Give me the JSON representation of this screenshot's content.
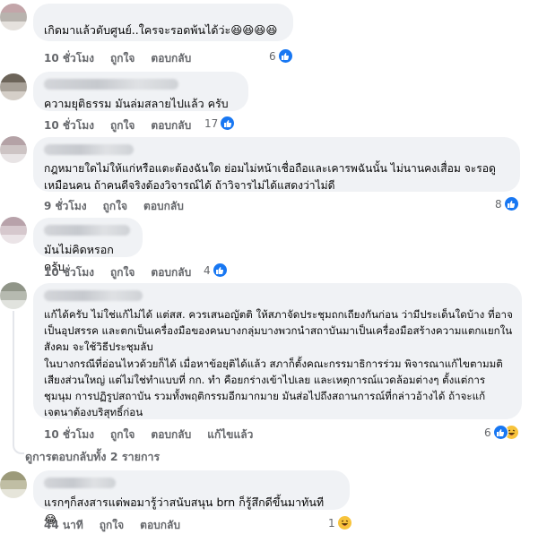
{
  "comments": [
    {
      "text": "เกิดมาแล้วดับศูนย์..ใครจะรอดพ้นได้ว่ะ😆😆😆😆",
      "time": "10 ชั่วโมง",
      "like": "ถูกใจ",
      "reply": "ตอบกลับ",
      "edit": "",
      "reaction_count": "6",
      "reactions": [
        "like-icon"
      ]
    },
    {
      "text": "ความยุติธรรม มันล่มสลายไปแล้ว ครับ",
      "time": "10 ชั่วโมง",
      "like": "ถูกใจ",
      "reply": "ตอบกลับ",
      "edit": "",
      "reaction_count": "17",
      "reactions": [
        "like-icon"
      ]
    },
    {
      "text": "กฎหมายใดไม่ให้แก่หรือแตะต้องฉันใด ย่อมไม่หน้าเชื่อถือและเคารพฉันนั้น ไม่นานคงเสื่อม จะรอดู เหมือนคน ถ้าคนดีจริงต้องวิจารณ์ได้ ถ้าวิจารไม่ได้แสดงว่าไม่ดี",
      "time": "9 ชั่วโมง",
      "like": "ถูกใจ",
      "reply": "ตอบกลับ",
      "edit": "",
      "reaction_count": "8",
      "reactions": [
        "like-icon"
      ]
    },
    {
      "text": "มันไม่คิดหรอกครับ",
      "time": "10 ชั่วโมง",
      "like": "ถูกใจ",
      "reply": "ตอบกลับ",
      "edit": "",
      "reaction_count": "4",
      "reactions": [
        "like-icon"
      ]
    },
    {
      "text": "แก้ได้ครับ ไม่ใช่แก้ไม่ได้ แต่สส. ควรเสนอญัตติ ให้สภาจัดประชุมถกเถียงกันก่อน ว่ามีประเด็นใดบ้าง ที่อาจเป็นอุปสรรค และตกเป็นเครื่องมือของคนบางกลุ่มบางพวกนำสถาบันมาเป็นเครื่องมือสร้างความแตกแยกในสังคม จะใช้วิธีประชุมลับ\nในบางกรณีที่อ่อนไหวด้วยก็ได้ เมื่อหาข้อยุติได้แล้ว สภาก็ตั้งคณะกรรมาธิการร่วม พิจารณาแก้ไขตามมติเสียงส่วนใหญ่ แต่ไม่ใช่ทำแบบที่ กก. ทำ คือยกร่างเข้าไปเลย และเหตุการณ์แวดล้อมต่างๆ ตั้งแต่การชุมนุม การปฏิรูปสถาบัน รวมทั้งพฤติกรรมอีกมากมาย มันส่อไปถึงสถานการณ์ที่กล่าวอ้างได้ ถ้าจะแก้ เจตนาต้องบริสุทธิ์ก่อน",
      "time": "10 ชั่วโมง",
      "like": "ถูกใจ",
      "reply": "ตอบกลับ",
      "edit": "แก้ไขแล้ว",
      "reaction_count": "6",
      "reactions": [
        "like-icon",
        "haha-icon"
      ]
    },
    {
      "text": "แรกๆก็สงสารแต่พอมารู้ว่าสนับสนุน brn ก็รู้สึกดีขึ้นมาทันที 😂",
      "time": "44 นาที",
      "like": "ถูกใจ",
      "reply": "ตอบกลับ",
      "edit": "",
      "reaction_count": "1",
      "reactions": [
        "haha-icon"
      ]
    }
  ],
  "view_replies": "ดูการตอบกลับทั้ง 2 รายการ",
  "colors": {
    "bubble": "#f0f2f5",
    "meta": "#65676b",
    "like_blue": "#1877f2",
    "haha_yellow": "#f7c33b"
  }
}
